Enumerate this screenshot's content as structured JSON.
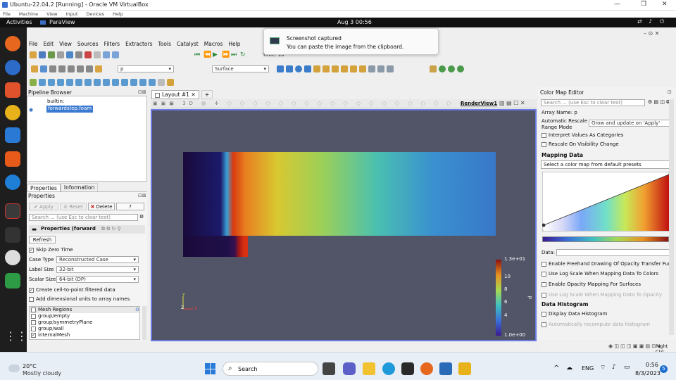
{
  "vbox": {
    "title": "Ubuntu-22.04.2 [Running] - Oracle VM VirtualBox",
    "menu": [
      "File",
      "Machine",
      "View",
      "Input",
      "Devices",
      "Help"
    ]
  },
  "gnome": {
    "activities": "Activities",
    "app": "ParaView",
    "clock": "Aug 3  00:56"
  },
  "notification": {
    "title": "Screenshot captured",
    "body": "You can paste the image from the clipboard."
  },
  "paraview": {
    "menu": [
      "File",
      "Edit",
      "View",
      "Sources",
      "Filters",
      "Extractors",
      "Tools",
      "Catalyst",
      "Macros",
      "Help"
    ],
    "time_label": "Time: 10",
    "array_select": "p",
    "representation": "Surface",
    "pipeline": {
      "title": "Pipeline Browser",
      "items": [
        "builtin:",
        "forwardstep.foam"
      ]
    },
    "tabs": [
      "Properties",
      "Information"
    ],
    "properties": {
      "title": "Properties",
      "apply": "Apply",
      "reset": "Reset",
      "delete": "Delete",
      "help": "?",
      "search_placeholder": "Search ... (use Esc to clear text)",
      "section": "Properties (forward",
      "refresh": "Refresh",
      "skip_zero": "Skip Zero Time",
      "case_type_label": "Case Type",
      "case_type": "Reconstructed Case",
      "label_size_label": "Label Size",
      "label_size": "32-bit",
      "scalar_size_label": "Scalar Size",
      "scalar_size": "64-bit (DP)",
      "cell_to_point": "Create cell-to-point filtered data",
      "dim_units": "Add dimensional units to array names",
      "mesh_regions": "Mesh Regions",
      "regions": [
        "group/empty",
        "group/symmetryPlane",
        "group/wall",
        "internalMesh"
      ]
    },
    "layout_tab": "Layout #1",
    "render_view": "RenderView1",
    "colorbar": {
      "top": "1.3e+01",
      "ticks": [
        "10",
        "8",
        "6",
        "4"
      ],
      "bottom": "1.0e+00",
      "title": "p"
    },
    "axes": {
      "x": "X",
      "y": "Y",
      "z": "Z"
    },
    "cme": {
      "title": "Color Map Editor",
      "search_placeholder": "Search ... (use Esc to clear text)",
      "array_name": "Array Name: p",
      "auto_rescale_label": "Automatic Rescale Range Mode",
      "auto_rescale": "Grow and update on 'Apply'",
      "interpret": "Interpret Values As Categories",
      "rescale_vis": "Rescale On Visibility Change",
      "mapping": "Mapping Data",
      "preset": "Select a color map from default presets",
      "data_label": "Data:",
      "freehand": "Enable Freehand Drawing Of Opacity Transfer Fun",
      "log_scale": "Use Log Scale When Mapping Data To Colors",
      "opacity": "Enable Opacity Mapping For Surfaces",
      "log_opacity": "Use Log Scale When Mapping Data To Opacity",
      "histogram": "Data Histogram",
      "display_hist": "Display Data Histogram",
      "auto_hist": "Automatically recompute data histogram"
    }
  },
  "taskbar": {
    "weather_temp": "20°C",
    "weather_desc": "Mostly cloudy",
    "search": "Search",
    "lang": "ENG",
    "time": "0:56",
    "date": "8/3/2023",
    "badge": "5",
    "right_ctrl": "Right Ctrl"
  }
}
